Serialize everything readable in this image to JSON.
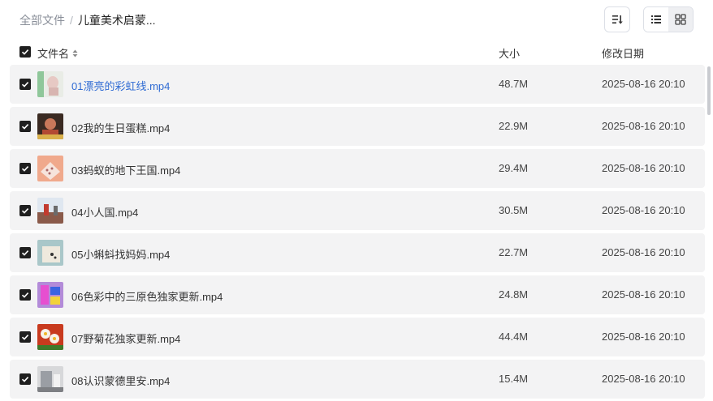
{
  "breadcrumb": {
    "root": "全部文件",
    "separator": "/",
    "current": "儿童美术启蒙..."
  },
  "toolbar": {
    "sort_icon": "sort-icon",
    "list_view_icon": "list-view-icon",
    "grid_view_icon": "grid-view-icon",
    "active_view": "list"
  },
  "columns": {
    "name": "文件名",
    "size": "大小",
    "modified": "修改日期"
  },
  "files": [
    {
      "name": "01漂亮的彩虹线.mp4",
      "size": "48.7M",
      "date": "2025-08-16 20:10",
      "checked": true,
      "highlight": true
    },
    {
      "name": "02我的生日蛋糕.mp4",
      "size": "22.9M",
      "date": "2025-08-16 20:10",
      "checked": true,
      "highlight": false
    },
    {
      "name": "03蚂蚁的地下王国.mp4",
      "size": "29.4M",
      "date": "2025-08-16 20:10",
      "checked": true,
      "highlight": false
    },
    {
      "name": "04小人国.mp4",
      "size": "30.5M",
      "date": "2025-08-16 20:10",
      "checked": true,
      "highlight": false
    },
    {
      "name": "05小蝌蚪找妈妈.mp4",
      "size": "22.7M",
      "date": "2025-08-16 20:10",
      "checked": true,
      "highlight": false
    },
    {
      "name": "06色彩中的三原色独家更新.mp4",
      "size": "24.8M",
      "date": "2025-08-16 20:10",
      "checked": true,
      "highlight": false
    },
    {
      "name": "07野菊花独家更新.mp4",
      "size": "44.4M",
      "date": "2025-08-16 20:10",
      "checked": true,
      "highlight": false
    },
    {
      "name": "08认识蒙德里安.mp4",
      "size": "15.4M",
      "date": "2025-08-16 20:10",
      "checked": true,
      "highlight": false
    }
  ],
  "colors": {
    "link": "#2f6bd3",
    "row_bg": "#f3f3f4",
    "checkbox": "#1f1f1f"
  }
}
